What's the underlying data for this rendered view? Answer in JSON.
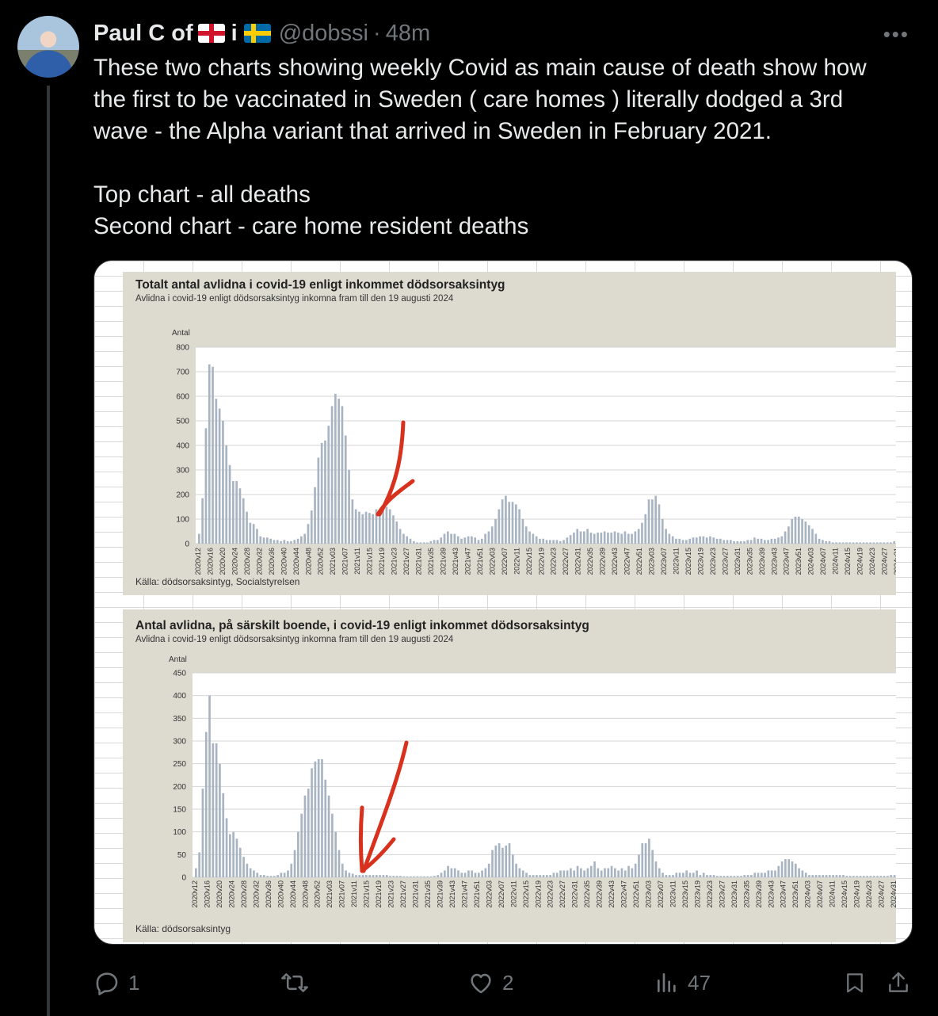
{
  "user": {
    "display_name": "Paul C of",
    "connector": "i",
    "flags": [
      "england-flag-icon",
      "sweden-flag-icon"
    ],
    "handle": "@dobssi",
    "time": "48m"
  },
  "tweet": {
    "lines": [
      "These two charts showing weekly Covid as main cause of death show how",
      "the first to be vaccinated in Sweden ( care homes ) literally dodged a 3rd",
      "wave - the Alpha variant that arrived in Sweden in February 2021.",
      "",
      "Top chart - all deaths",
      "Second chart - care home resident deaths"
    ]
  },
  "actions": {
    "reply_count": "1",
    "retweet_count": "",
    "like_count": "2",
    "views_count": "47"
  },
  "colors": {
    "accent_arrow": "#d8321e",
    "bar_fill": "#a9b4c2",
    "panel_bg": "#dddbd0"
  },
  "chart_data": [
    {
      "type": "bar",
      "title": "Totalt antal avlidna i covid-19 enligt inkommet dödsorsaksintyg",
      "subtitle": "Avlidna i covid-19 enligt dödsorsaksintyg inkomna fram till den 19 augusti 2024",
      "ylabel": "Antal",
      "source": "Källa: dödsorsaksintyg, Socialstyrelsen",
      "ylim": [
        0,
        800
      ],
      "yticks": [
        0,
        100,
        200,
        300,
        400,
        500,
        600,
        700,
        800
      ],
      "tick_labels": [
        "2020v12",
        "2020v16",
        "2020v20",
        "2020v24",
        "2020v28",
        "2020v32",
        "2020v36",
        "2020v40",
        "2020v44",
        "2020v48",
        "2020v52",
        "2021v03",
        "2021v07",
        "2021v11",
        "2021v15",
        "2021v19",
        "2021v23",
        "2021v27",
        "2021v31",
        "2021v35",
        "2021v39",
        "2021v43",
        "2021v47",
        "2021v51",
        "2022v03",
        "2022v07",
        "2022v11",
        "2022v15",
        "2022v19",
        "2022v23",
        "2022v27",
        "2022v31",
        "2022v35",
        "2022v39",
        "2022v43",
        "2022v47",
        "2022v51",
        "2023v03",
        "2023v07",
        "2023v11",
        "2023v15",
        "2023v19",
        "2023v23",
        "2023v27",
        "2023v31",
        "2023v35",
        "2023v39",
        "2023v43",
        "2023v47",
        "2023v51",
        "2024v03",
        "2024v07",
        "2024v11",
        "2024v15",
        "2024v19",
        "2024v23",
        "2024v27",
        "2024v31"
      ],
      "values": [
        40,
        185,
        470,
        730,
        720,
        590,
        550,
        500,
        400,
        320,
        255,
        255,
        225,
        185,
        130,
        85,
        80,
        60,
        30,
        25,
        25,
        20,
        15,
        15,
        10,
        15,
        10,
        10,
        15,
        20,
        30,
        40,
        80,
        135,
        230,
        350,
        410,
        420,
        480,
        560,
        610,
        590,
        560,
        440,
        300,
        180,
        140,
        130,
        120,
        130,
        125,
        120,
        140,
        125,
        135,
        150,
        140,
        115,
        90,
        60,
        40,
        30,
        20,
        10,
        5,
        5,
        5,
        5,
        10,
        15,
        15,
        25,
        40,
        50,
        40,
        40,
        30,
        20,
        25,
        30,
        30,
        25,
        15,
        20,
        40,
        50,
        70,
        100,
        140,
        180,
        195,
        170,
        170,
        160,
        140,
        100,
        70,
        50,
        40,
        30,
        20,
        20,
        15,
        15,
        15,
        15,
        10,
        15,
        25,
        35,
        45,
        60,
        50,
        50,
        60,
        45,
        40,
        45,
        45,
        50,
        45,
        45,
        50,
        45,
        40,
        50,
        40,
        40,
        50,
        60,
        85,
        120,
        180,
        180,
        195,
        160,
        100,
        60,
        40,
        30,
        20,
        20,
        15,
        15,
        20,
        25,
        25,
        30,
        30,
        25,
        30,
        25,
        20,
        20,
        15,
        15,
        15,
        10,
        10,
        10,
        10,
        15,
        15,
        25,
        20,
        20,
        15,
        15,
        20,
        20,
        25,
        30,
        50,
        70,
        100,
        110,
        110,
        100,
        90,
        75,
        60,
        40,
        20,
        15,
        10,
        10,
        5,
        5,
        5,
        5,
        5,
        5,
        5,
        5,
        5,
        5,
        5,
        5,
        5,
        5,
        5,
        5,
        5,
        5,
        10,
        10
      ]
    },
    {
      "type": "bar",
      "title": "Antal avlidna, på särskilt boende, i covid-19 enligt inkommet dödsorsaksintyg",
      "subtitle": "Avlidna i covid-19 enligt dödsorsaksintyg inkomna fram till den 19 augusti 2024",
      "ylabel": "Antal",
      "source": "Källa: dödsorsaksintyg",
      "ylim": [
        0,
        450
      ],
      "yticks": [
        0,
        50,
        100,
        150,
        200,
        250,
        300,
        350,
        400,
        450
      ],
      "tick_labels": [
        "2020v12",
        "2020v16",
        "2020v20",
        "2020v24",
        "2020v28",
        "2020v32",
        "2020v36",
        "2020v40",
        "2020v44",
        "2020v48",
        "2020v52",
        "2021v03",
        "2021v07",
        "2021v11",
        "2021v15",
        "2021v19",
        "2021v23",
        "2021v27",
        "2021v31",
        "2021v35",
        "2021v39",
        "2021v43",
        "2021v47",
        "2021v51",
        "2022v03",
        "2022v07",
        "2022v11",
        "2022v15",
        "2022v19",
        "2022v23",
        "2022v27",
        "2022v31",
        "2022v35",
        "2022v39",
        "2022v43",
        "2022v47",
        "2022v51",
        "2023v03",
        "2023v07",
        "2023v11",
        "2023v15",
        "2023v19",
        "2023v23",
        "2023v27",
        "2023v31",
        "2023v35",
        "2023v39",
        "2023v43",
        "2023v47",
        "2023v51",
        "2024v03",
        "2024v07",
        "2024v11",
        "2024v15",
        "2024v19",
        "2024v23",
        "2024v27",
        "2024v31"
      ],
      "values": [
        20,
        55,
        195,
        320,
        400,
        295,
        295,
        250,
        185,
        130,
        95,
        100,
        85,
        65,
        45,
        30,
        20,
        15,
        10,
        5,
        5,
        3,
        3,
        3,
        5,
        10,
        10,
        15,
        30,
        60,
        100,
        140,
        180,
        195,
        240,
        255,
        260,
        260,
        215,
        180,
        140,
        100,
        60,
        30,
        15,
        10,
        8,
        5,
        5,
        5,
        5,
        5,
        5,
        5,
        5,
        5,
        5,
        3,
        3,
        3,
        3,
        2,
        2,
        2,
        2,
        2,
        2,
        2,
        2,
        2,
        3,
        5,
        10,
        15,
        25,
        20,
        20,
        15,
        10,
        10,
        15,
        15,
        10,
        10,
        15,
        20,
        30,
        60,
        70,
        75,
        65,
        70,
        75,
        50,
        30,
        20,
        15,
        10,
        5,
        5,
        5,
        5,
        5,
        5,
        5,
        10,
        10,
        15,
        15,
        15,
        20,
        15,
        25,
        20,
        15,
        20,
        25,
        35,
        20,
        15,
        20,
        20,
        25,
        20,
        15,
        20,
        15,
        25,
        20,
        30,
        50,
        75,
        75,
        85,
        60,
        35,
        20,
        10,
        5,
        5,
        5,
        10,
        10,
        10,
        15,
        10,
        10,
        15,
        5,
        10,
        5,
        5,
        5,
        3,
        3,
        3,
        3,
        3,
        3,
        3,
        3,
        5,
        5,
        5,
        10,
        10,
        10,
        10,
        15,
        15,
        15,
        25,
        35,
        40,
        40,
        35,
        30,
        20,
        15,
        10,
        5,
        5,
        5,
        5,
        5,
        5,
        5,
        5,
        5,
        5,
        5,
        3,
        3,
        3,
        3,
        3,
        3,
        3,
        3,
        3,
        3,
        3,
        3,
        3,
        5,
        5
      ]
    }
  ]
}
